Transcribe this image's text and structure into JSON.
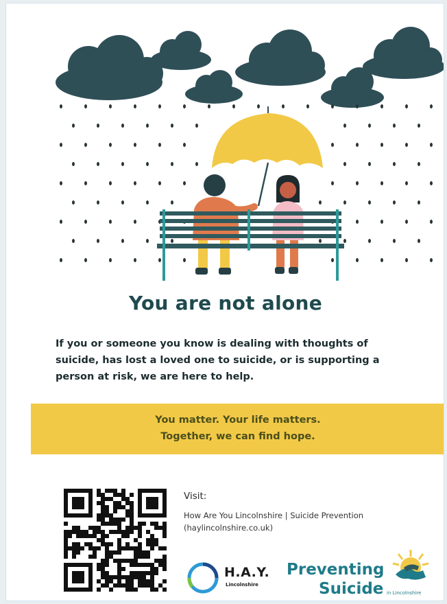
{
  "headline": "You are not alone",
  "body": {
    "line1": "If you or someone you know is dealing with thoughts of",
    "line2": "suicide, has lost a loved one to suicide, or is supporting a",
    "line3": "person at risk, we are here to help."
  },
  "banner": {
    "line1": "You matter. Your life matters.",
    "line2": "Together, we can find hope."
  },
  "visit": {
    "label": "Visit:",
    "link_line1": "How Are You Lincolnshire | Suicide Prevention",
    "link_line2": "(haylincolnshire.co.uk)"
  },
  "logos": {
    "hay_title": "H.A.Y.",
    "hay_subtitle": "Lincolnshire",
    "ps_line1": "Preventing",
    "ps_line2": "Suicide",
    "ps_subtitle": "in Lincolnshire"
  },
  "colors": {
    "cloud": "#2f4f57",
    "rain": "#2a3434",
    "umbrella": "#f2c947",
    "bench": "#2f5a5e",
    "bench_legs": "#2e9a9a",
    "banner": "#f2c947",
    "headline": "#1f4a4e",
    "brand_teal": "#1f7b89"
  },
  "icons": {
    "illustration": "rain-bench-umbrella-illustration",
    "qr": "qr-code-icon",
    "hay_logo": "hay-ring-logo-icon",
    "ps_logo": "sun-hands-logo-icon"
  }
}
